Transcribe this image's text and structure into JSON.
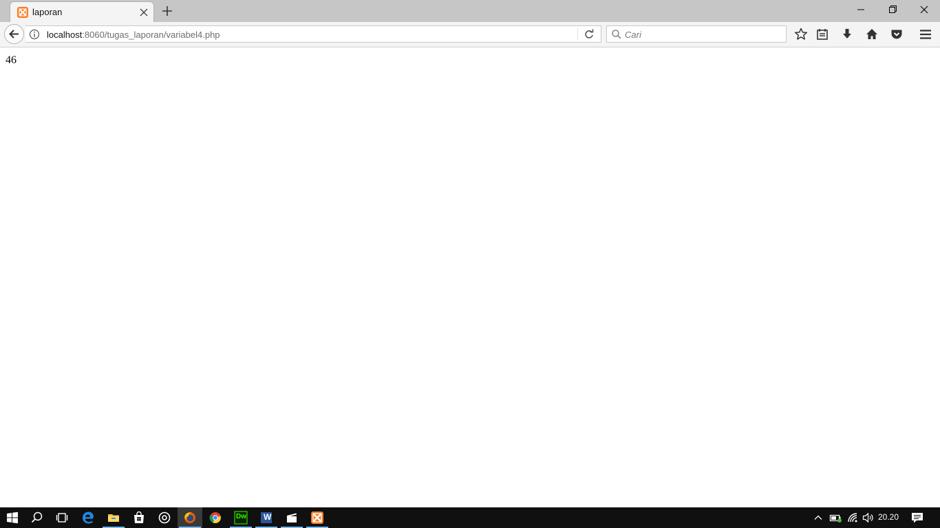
{
  "browser": {
    "tab": {
      "title": "laporan",
      "favicon": "xampp-icon"
    },
    "url": {
      "host": "localhost",
      "rest": ":8060/tugas_laporan/variabel4.php"
    },
    "search": {
      "placeholder": "Cari"
    },
    "toolbar_icons": [
      "star-icon",
      "reading-list-icon",
      "download-icon",
      "home-icon",
      "pocket-icon",
      "menu-icon"
    ],
    "window_controls": [
      "minimize-icon",
      "restore-icon",
      "close-icon"
    ]
  },
  "page": {
    "content": "46"
  },
  "taskbar": {
    "apps": [
      "start-icon",
      "search-icon",
      "task-view-icon",
      "edge-icon",
      "file-explorer-icon",
      "store-icon",
      "groove-icon",
      "firefox-icon",
      "chrome-icon",
      "dreamweaver-icon",
      "word-icon",
      "movies-icon",
      "xampp-icon"
    ],
    "dw_label": "Dw",
    "word_label": "W",
    "active_app": "firefox-icon",
    "clock": "20.20"
  },
  "colors": {
    "tabbar": "#c6c6c6",
    "navbar": "#f4f4f4",
    "taskbar": "#101010",
    "accent": "#76b9ed",
    "xampp": "#fb7a24"
  }
}
